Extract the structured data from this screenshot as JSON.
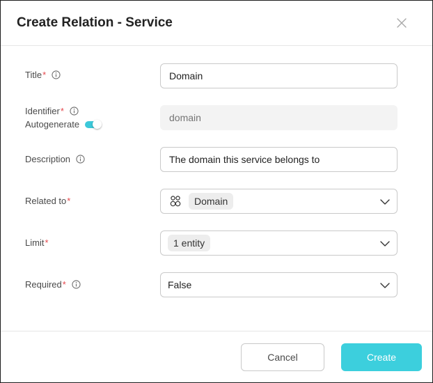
{
  "dialog": {
    "title": "Create Relation - Service"
  },
  "fields": {
    "title": {
      "label": "Title",
      "required_mark": "*",
      "value": "Domain"
    },
    "identifier": {
      "label": "Identifier",
      "required_mark": "*",
      "placeholder": "domain",
      "autogenerate_label": "Autogenerate",
      "autogenerate_on": true
    },
    "description": {
      "label": "Description",
      "value": "The domain this service belongs to"
    },
    "related_to": {
      "label": "Related to",
      "required_mark": "*",
      "value": "Domain",
      "icon": "entity-icon"
    },
    "limit": {
      "label": "Limit",
      "required_mark": "*",
      "value": "1 entity"
    },
    "required": {
      "label": "Required",
      "required_mark": "*",
      "value": "False"
    }
  },
  "footer": {
    "cancel_label": "Cancel",
    "create_label": "Create"
  },
  "colors": {
    "accent": "#3ccfdd",
    "required": "#e5484d"
  }
}
